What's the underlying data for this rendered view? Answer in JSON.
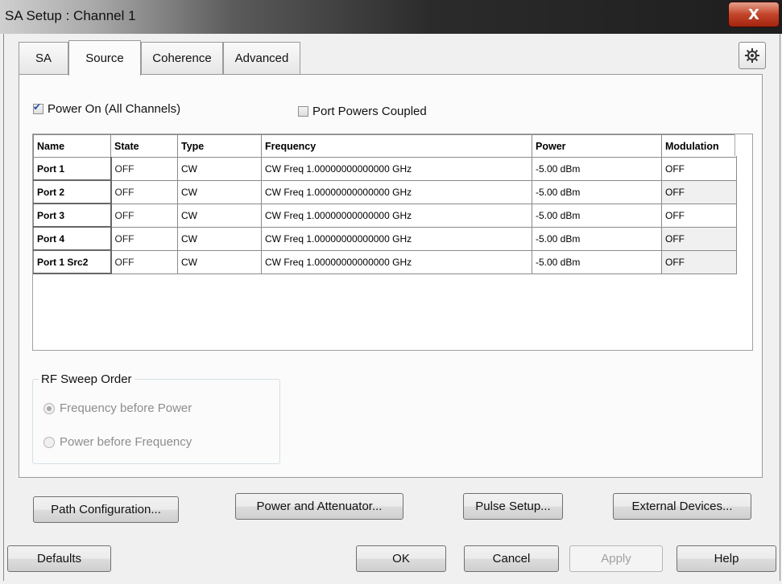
{
  "window": {
    "title": "SA Setup : Channel 1",
    "close_label": "X"
  },
  "tabs": [
    {
      "label": "SA"
    },
    {
      "label": "Source",
      "active": true
    },
    {
      "label": "Coherence"
    },
    {
      "label": "Advanced"
    }
  ],
  "settings_icon": "gear-icon",
  "power_on": {
    "label": "Power On (All Channels)",
    "checked": true
  },
  "port_powers_coupled": {
    "label": "Port Powers Coupled",
    "checked": false
  },
  "table": {
    "headers": [
      "Name",
      "State",
      "Type",
      "Frequency",
      "Power",
      "Modulation"
    ],
    "rows": [
      [
        "Port 1",
        "OFF",
        "CW",
        "CW Freq 1.00000000000000 GHz",
        "-5.00 dBm",
        "OFF"
      ],
      [
        "Port 2",
        "OFF",
        "CW",
        "CW Freq 1.00000000000000 GHz",
        "-5.00 dBm",
        "OFF"
      ],
      [
        "Port 3",
        "OFF",
        "CW",
        "CW Freq 1.00000000000000 GHz",
        "-5.00 dBm",
        "OFF"
      ],
      [
        "Port 4",
        "OFF",
        "CW",
        "CW Freq 1.00000000000000 GHz",
        "-5.00 dBm",
        "OFF"
      ],
      [
        "Port 1 Src2",
        "OFF",
        "CW",
        "CW Freq 1.00000000000000 GHz",
        "-5.00 dBm",
        "OFF"
      ]
    ]
  },
  "sweep_order": {
    "label": "RF Sweep Order",
    "options": [
      "Frequency before Power",
      "Power before Frequency"
    ],
    "selected": "Frequency before Power",
    "enabled": false
  },
  "panel_buttons": {
    "path_configuration": "Path Configuration...",
    "power_attenuator": "Power and Attenuator...",
    "pulse_setup": "Pulse Setup...",
    "external_devices": "External Devices..."
  },
  "dialog_buttons": {
    "defaults": "Defaults",
    "ok": "OK",
    "cancel": "Cancel",
    "apply": "Apply",
    "help": "Help"
  },
  "colors": {
    "checkmark": "#1c4fa8",
    "close_button": "#c2452a",
    "disabled_text": "#a0a0a0"
  }
}
